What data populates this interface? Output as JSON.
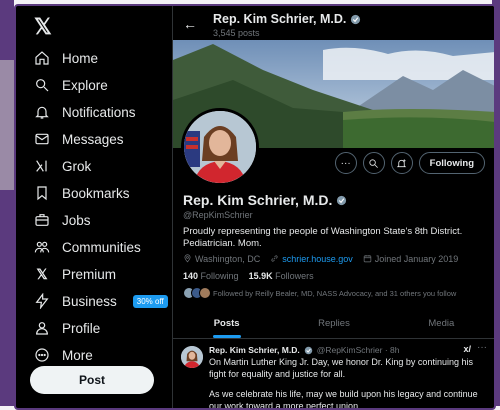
{
  "nav": {
    "items": [
      {
        "label": "Home",
        "icon": "home-icon"
      },
      {
        "label": "Explore",
        "icon": "search-icon"
      },
      {
        "label": "Notifications",
        "icon": "bell-icon"
      },
      {
        "label": "Messages",
        "icon": "mail-icon"
      },
      {
        "label": "Grok",
        "icon": "grok-icon"
      },
      {
        "label": "Bookmarks",
        "icon": "bookmark-icon"
      },
      {
        "label": "Jobs",
        "icon": "briefcase-icon"
      },
      {
        "label": "Communities",
        "icon": "people-icon"
      },
      {
        "label": "Premium",
        "icon": "x-logo-icon"
      },
      {
        "label": "Business",
        "icon": "lightning-icon",
        "badge": "30% off"
      },
      {
        "label": "Profile",
        "icon": "person-icon"
      },
      {
        "label": "More",
        "icon": "more-circle-icon"
      }
    ],
    "post_label": "Post"
  },
  "header": {
    "name": "Rep. Kim Schrier, M.D.",
    "posts_count": "3,545 posts"
  },
  "profile": {
    "name": "Rep. Kim Schrier, M.D.",
    "handle": "@RepKimSchrier",
    "bio": "Proudly representing the people of Washington State's 8th District. Pediatrician. Mom.",
    "location": "Washington, DC",
    "website": "schrier.house.gov",
    "joined": "Joined January 2019",
    "following_count": "140",
    "following_label": "Following",
    "followers_count": "15.9K",
    "followers_label": "Followers",
    "followed_by": "Followed by Reilly Bealer, MD, NASS Advocacy, and 31 others you follow",
    "follow_button": "Following"
  },
  "tabs": [
    {
      "label": "Posts",
      "active": true
    },
    {
      "label": "Replies",
      "active": false
    },
    {
      "label": "Media",
      "active": false
    }
  ],
  "tweet": {
    "name": "Rep. Kim Schrier, M.D.",
    "handle": "@RepKimSchrier · 8h",
    "para1": "On Martin Luther King Jr. Day, we honor Dr. King by continuing his fight for equality and justice for all.",
    "para2": "As we celebrate his life, may we build upon his legacy and continue our work toward a more perfect union."
  },
  "colors": {
    "accent": "#1d9bf0",
    "background": "#000000",
    "frame": "#5b3a7e"
  }
}
